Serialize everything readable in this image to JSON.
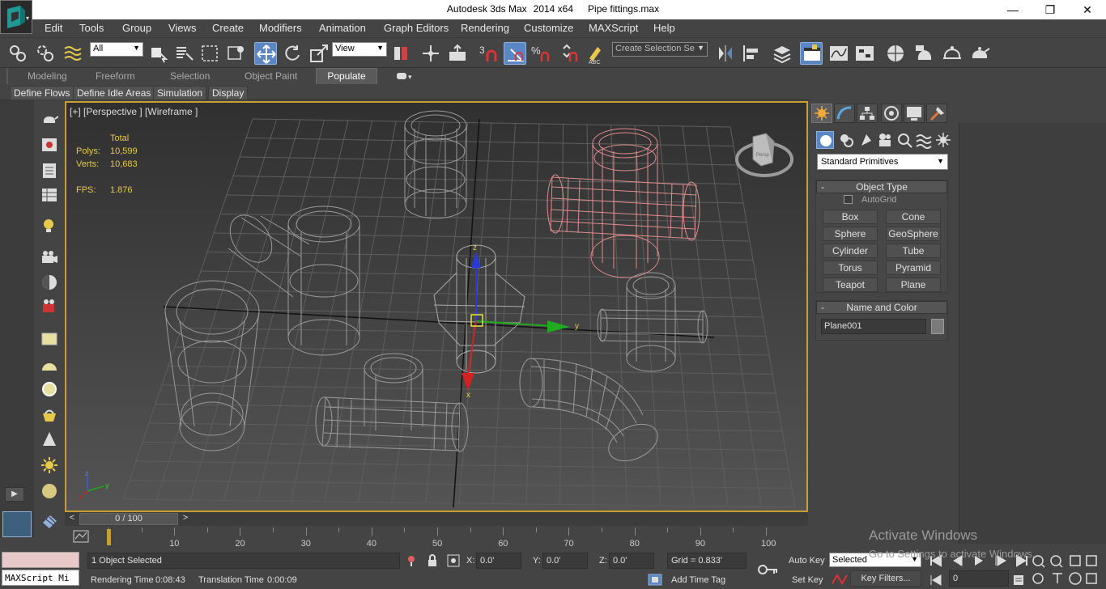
{
  "titlebar": {
    "app": "Autodesk 3ds Max",
    "version": "2014 x64",
    "file": "Pipe fittings.max",
    "minimize": "—",
    "maximize": "❐",
    "close": "✕"
  },
  "menu": [
    "Edit",
    "Tools",
    "Group",
    "Views",
    "Create",
    "Modifiers",
    "Animation",
    "Graph Editors",
    "Rendering",
    "Customize",
    "MAXScript",
    "Help"
  ],
  "toolbar": {
    "filter_value": "All",
    "coord_value": "View",
    "snap_label": "3",
    "selection_set_placeholder": "Create Selection Se"
  },
  "ribbon": {
    "tabs": [
      "Modeling",
      "Freeform",
      "Selection",
      "Object Paint",
      "Populate"
    ],
    "active_tab": "Populate",
    "subtabs": [
      "Define Flows",
      "Define Idle Areas",
      "Simulation",
      "Display"
    ]
  },
  "viewport": {
    "label": "[+] [Perspective ] [Wireframe ]",
    "stats_header": "Total",
    "polys_label": "Polys:",
    "polys": "10,599",
    "verts_label": "Verts:",
    "verts": "10,683",
    "fps_label": "FPS:",
    "fps": "1.876",
    "viewcube_label": "Persp",
    "axis_x": "x",
    "axis_y": "y",
    "axis_z": "z"
  },
  "command_panel": {
    "category": "Standard Primitives",
    "object_type_title": "Object Type",
    "autogrid_label": "AutoGrid",
    "buttons": [
      "Box",
      "Cone",
      "Sphere",
      "GeoSphere",
      "Cylinder",
      "Tube",
      "Torus",
      "Pyramid",
      "Teapot",
      "Plane"
    ],
    "name_color_title": "Name and Color",
    "object_name": "Plane001",
    "object_color": "#7a7a7a"
  },
  "timeline": {
    "frame_display": "0 / 100",
    "prev": "<",
    "next": ">",
    "ticks": [
      "10",
      "20",
      "30",
      "40",
      "50",
      "60",
      "70",
      "80",
      "90",
      "100"
    ]
  },
  "status": {
    "maxscript_label": "MAXScript Mi",
    "selection_message": "1 Object Selected",
    "rendering_time_label": "Rendering Time",
    "rendering_time": "0:08:43",
    "translation_time_label": "Translation Time",
    "translation_time": "0:00:09",
    "x_label": "X:",
    "x_value": "0.0'",
    "y_label": "Y:",
    "y_value": "0.0'",
    "z_label": "Z:",
    "z_value": "0.0'",
    "grid": "Grid = 0.833'",
    "add_time_tag": "Add Time Tag",
    "auto_key": "Auto Key",
    "set_key": "Set Key",
    "key_mode_value": "Selected",
    "key_filters": "Key Filters...",
    "frame_value": "0"
  },
  "watermark": {
    "line1": "Activate Windows",
    "line2": "Go to Settings to activate Windows."
  },
  "colors": {
    "accent": "#5a86c4",
    "viewport_border": "#c8a032",
    "wire_gray": "#9a9a9a",
    "wire_selected": "#e08c8c",
    "stats_yellow": "#e6c94a"
  }
}
